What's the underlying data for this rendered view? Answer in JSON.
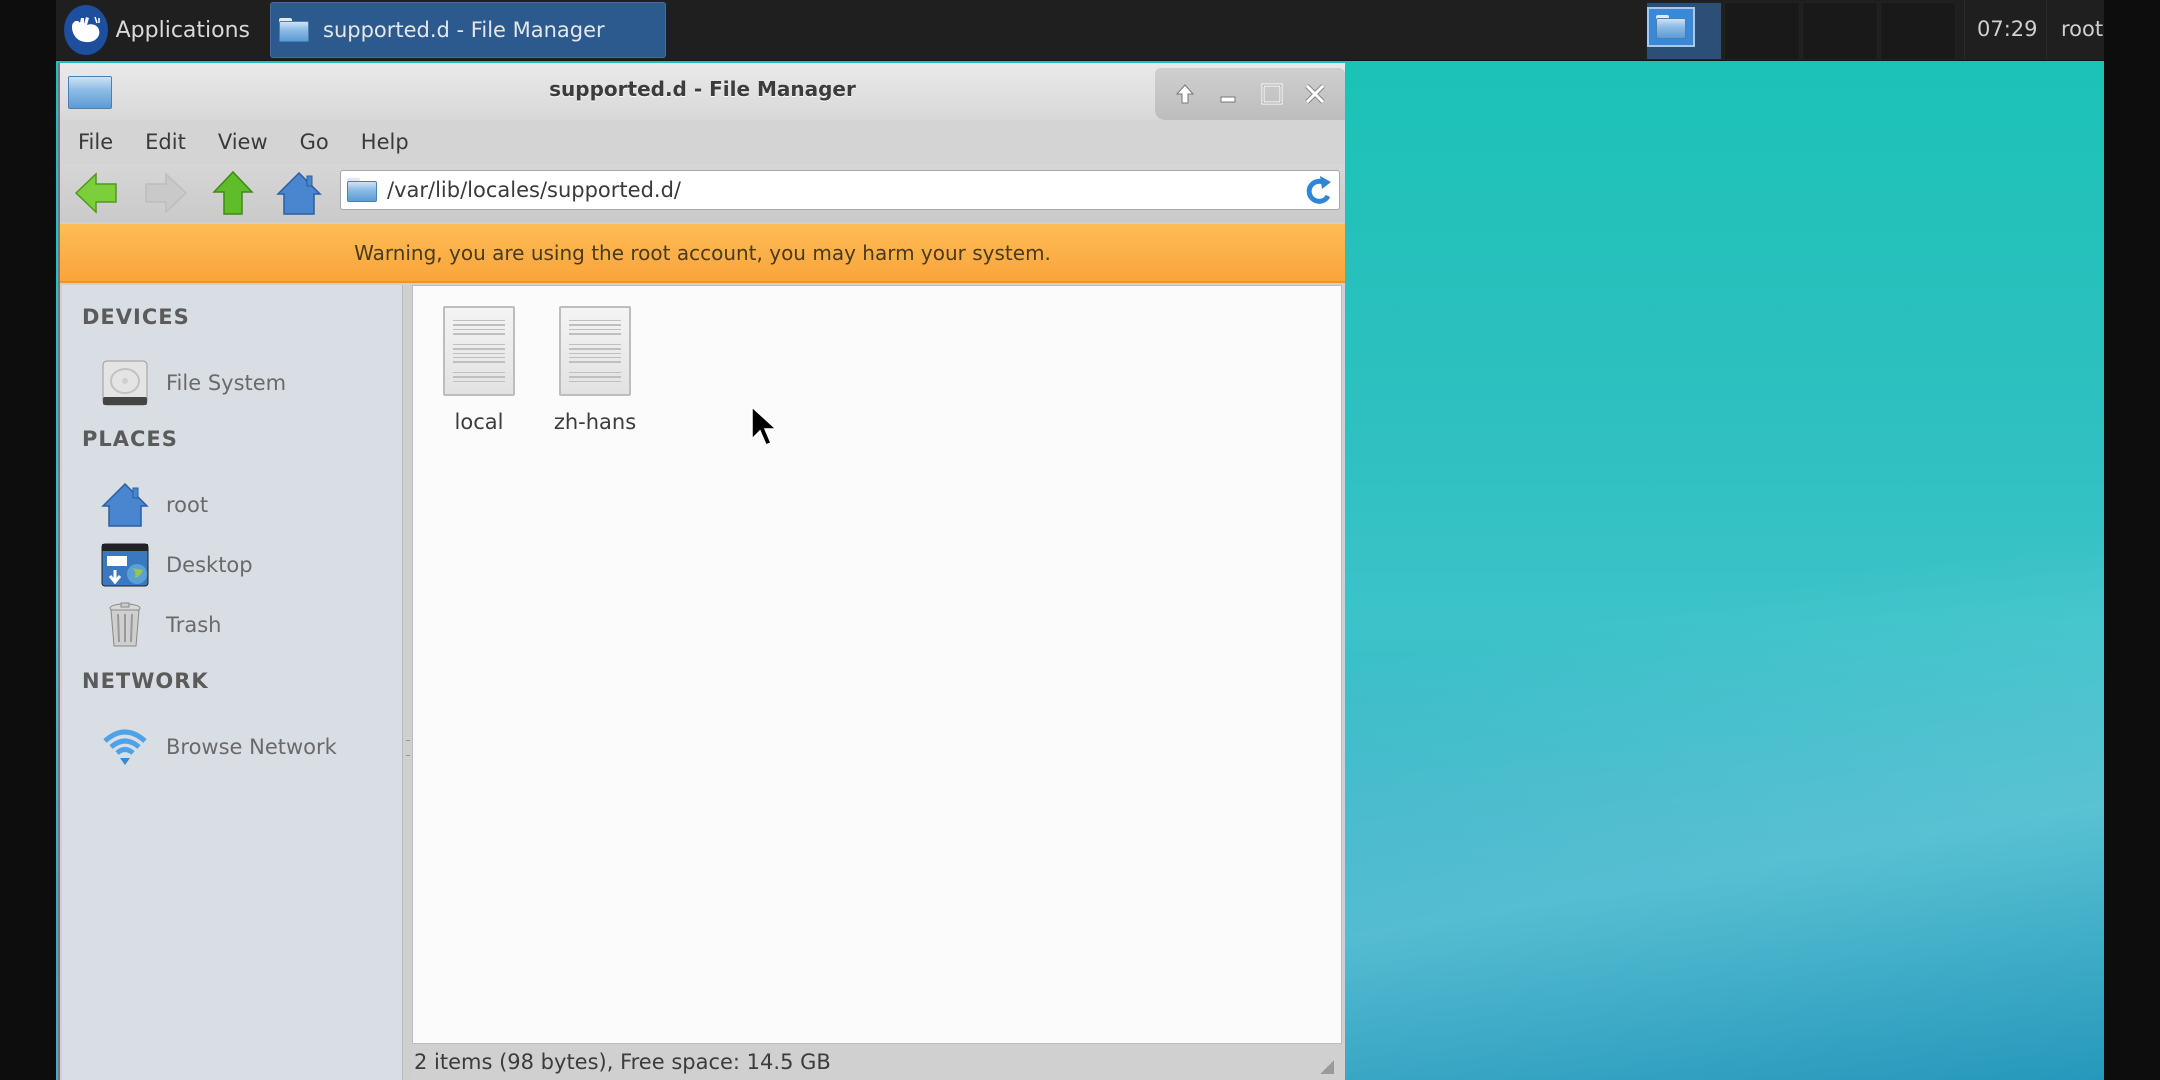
{
  "panel": {
    "applications_label": "Applications",
    "task_label": "supported.d - File Manager",
    "workspaces": [
      {
        "index": 1,
        "active": true
      },
      {
        "index": 2,
        "active": false
      },
      {
        "index": 3,
        "active": false
      },
      {
        "index": 4,
        "active": false
      }
    ],
    "clock": "07:29",
    "user": "root"
  },
  "window": {
    "title": "supported.d - File Manager",
    "controls": {
      "raise_icon": "arrow-up-icon",
      "minimize_icon": "minimize-icon",
      "maximize_icon": "maximize-icon",
      "close_icon": "close-icon"
    },
    "menu": [
      "File",
      "Edit",
      "View",
      "Go",
      "Help"
    ],
    "toolbar": {
      "back_icon": "back-arrow-icon",
      "forward_icon": "forward-arrow-icon",
      "forward_enabled": false,
      "up_icon": "up-arrow-icon",
      "home_icon": "home-icon",
      "location": "/var/lib/locales/supported.d/",
      "reload_icon": "reload-icon"
    },
    "warning": "Warning, you are using the root account, you may harm your system.",
    "sidebar": {
      "sections": [
        {
          "title": "DEVICES",
          "items": [
            {
              "label": "File System",
              "icon": "hard-drive-icon"
            }
          ]
        },
        {
          "title": "PLACES",
          "items": [
            {
              "label": "root",
              "icon": "home-icon"
            },
            {
              "label": "Desktop",
              "icon": "desktop-icon"
            },
            {
              "label": "Trash",
              "icon": "trash-icon"
            }
          ]
        },
        {
          "title": "NETWORK",
          "items": [
            {
              "label": "Browse Network",
              "icon": "network-icon"
            }
          ]
        }
      ]
    },
    "files": [
      {
        "name": "local",
        "icon": "text-document-icon"
      },
      {
        "name": "zh-hans",
        "icon": "text-document-icon"
      }
    ],
    "status": "2 items (98 bytes), Free space: 14.5 GB"
  },
  "colors": {
    "panel_bg": "#1f1f1f",
    "task_active": "#2d5a8e",
    "warning_bg": "#f8a53a",
    "sidebar_bg": "#d9dee5",
    "desktop_teal": "#1cc2b6"
  }
}
